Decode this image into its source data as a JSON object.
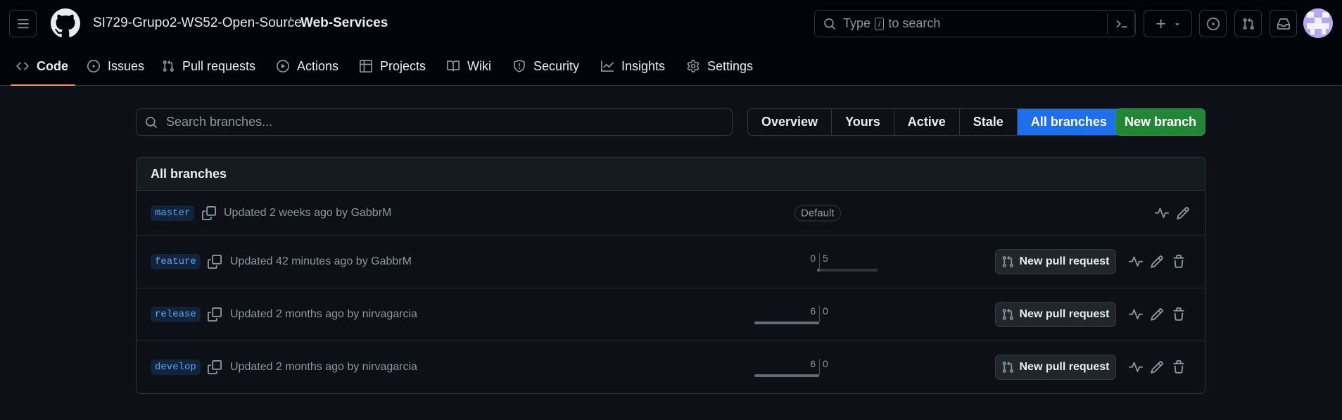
{
  "header": {
    "owner": "SI729-Grupo2-WS52-Open-Source",
    "separator": "/",
    "repo": "Web-Services",
    "search_before": "Type",
    "search_key": "/",
    "search_after": "to search"
  },
  "repo_nav": {
    "tabs": [
      {
        "label": "Code",
        "icon": "code-icon",
        "active": true
      },
      {
        "label": "Issues",
        "icon": "issue-opened-icon"
      },
      {
        "label": "Pull requests",
        "icon": "git-pull-request-icon"
      },
      {
        "label": "Actions",
        "icon": "play-icon"
      },
      {
        "label": "Projects",
        "icon": "table-icon"
      },
      {
        "label": "Wiki",
        "icon": "book-icon"
      },
      {
        "label": "Security",
        "icon": "shield-icon"
      },
      {
        "label": "Insights",
        "icon": "graph-icon"
      },
      {
        "label": "Settings",
        "icon": "gear-icon"
      }
    ]
  },
  "branches_page": {
    "search_placeholder": "Search branches...",
    "filters": [
      "Overview",
      "Yours",
      "Active",
      "Stale",
      "All branches"
    ],
    "selected_filter": "All branches",
    "new_branch_label": "New branch",
    "section_title": "All branches",
    "default_label": "Default",
    "new_pr_label": "New pull request",
    "rows": [
      {
        "name": "master",
        "meta": "Updated 2 weeks ago by GabbrM",
        "is_default": true
      },
      {
        "name": "feature",
        "meta": "Updated 42 minutes ago by GabbrM",
        "behind": "0",
        "ahead": "5"
      },
      {
        "name": "release",
        "meta": "Updated 2 months ago by nirvagarcia",
        "behind": "6",
        "ahead": "0"
      },
      {
        "name": "develop",
        "meta": "Updated 2 months ago by nirvagarcia",
        "behind": "6",
        "ahead": "0"
      }
    ]
  },
  "colors": {
    "accent_blue": "#1f6feb",
    "primary_green": "#238636",
    "active_tab_underline": "#fd8c73",
    "branch_label": "#58a6ff"
  }
}
